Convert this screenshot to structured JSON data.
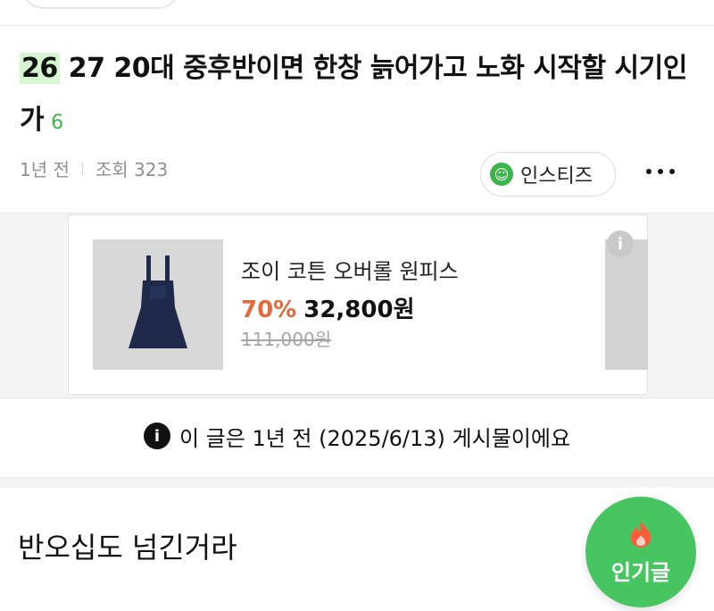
{
  "title": {
    "highlight": "26",
    "rest": " 27 20대 중후반이면 한창 늙어가고 노화 시작할 시기인가",
    "comment_count": "6"
  },
  "meta": {
    "time": "1년 전",
    "views": "조회 323"
  },
  "author": {
    "name": "인스티즈"
  },
  "ad": {
    "name": "조이 코튼 오버롤 원피스",
    "discount": "70%",
    "price": "32,800원",
    "original_price": "111,000원"
  },
  "notice": {
    "text": "이 글은 1년 전 (2025/6/13) 게시물이에요"
  },
  "body": {
    "text": "반오십도 넘긴거라"
  },
  "popular": {
    "label": "인기글"
  },
  "icons": {
    "author": "smile-icon",
    "more": "more-dots-icon",
    "ad_info": "info-icon",
    "notice": "info-icon",
    "popular": "fire-icon"
  },
  "colors": {
    "accent": "#3bb54a",
    "discount": "#e06a3a",
    "popular_bg": "#47c561"
  }
}
